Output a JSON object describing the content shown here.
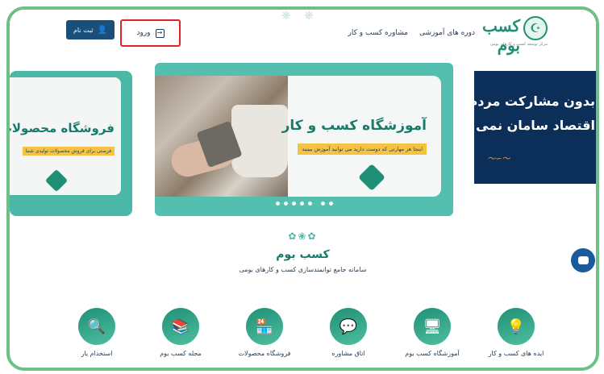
{
  "header": {
    "logo_text": "کسب بوم",
    "logo_sub": "مرکز توسعه کسب و کارهای بومی",
    "nav": [
      "دوره های آموزشی",
      "مشاوره کسب و کار"
    ],
    "login_label": "ورود",
    "signup_label": "ثبت نام"
  },
  "carousel": {
    "left_slide": {
      "title": "فروشگاه محصولات",
      "subtitle": "فرصتی برای فروش محصولات تولیدی شما"
    },
    "main_slide": {
      "headline": "آموزشگاه کسب و کار",
      "tagline": "اینجا هر مهارتی که دوست دارید می توانید آموزش ببینید"
    },
    "right_slide": {
      "line1": "بدون مشارکت مردم",
      "line2": "اقتصاد سامان نمی یابد"
    },
    "dots_count": 7
  },
  "intro": {
    "title": "کسب بوم",
    "subtitle": "سامانه جامع توانمندسازی کسب و کارهای بومی"
  },
  "features": [
    {
      "label": "ایده های کسب و کار",
      "icon": "lightbulb-icon"
    },
    {
      "label": "آموزشگاه کسب بوم",
      "icon": "monitor-teaching-icon"
    },
    {
      "label": "اتاق مشاوره",
      "icon": "chat-bubbles-icon"
    },
    {
      "label": "فروشگاه محصولات",
      "icon": "storefront-icon"
    },
    {
      "label": "مجله کسب بوم",
      "icon": "magazine-icon"
    },
    {
      "label": "استخدام یار",
      "icon": "resume-search-icon"
    }
  ],
  "colors": {
    "brand_green": "#1f8f76",
    "brand_blue": "#1a4f7a",
    "highlight_yellow": "#f5c242",
    "login_outline": "#e0242a"
  }
}
